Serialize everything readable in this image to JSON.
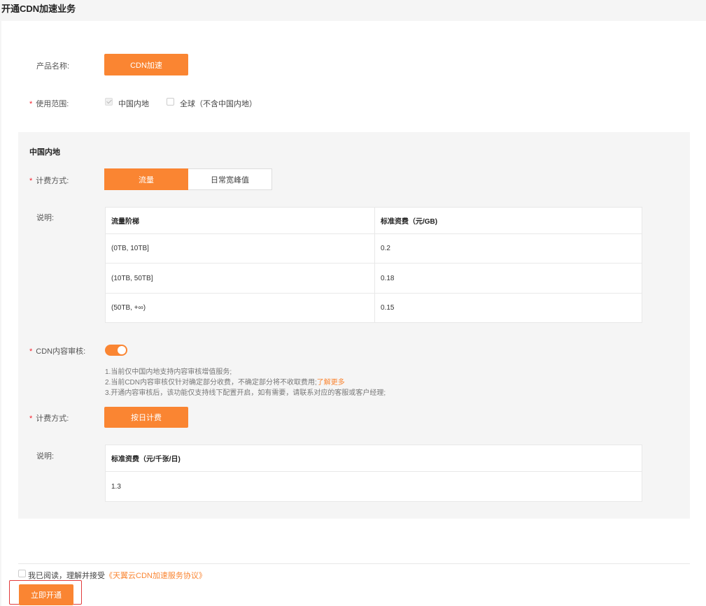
{
  "page": {
    "title": "开通CDN加速业务"
  },
  "product": {
    "label": "产品名称:",
    "value": "CDN加速"
  },
  "scope": {
    "required": "*",
    "label": "使用范围:",
    "options": [
      {
        "label": "中国内地",
        "checked": true,
        "disabled": true
      },
      {
        "label": "全球（不含中国内地）",
        "checked": false
      }
    ]
  },
  "region": {
    "title": "中国内地",
    "billing": {
      "required": "*",
      "label": "计费方式:",
      "options": [
        "流量",
        "日常宽峰值"
      ],
      "selected": "流量"
    },
    "desc_label": "说明:",
    "price_table": {
      "headers": [
        "流量阶梯",
        "标准资费（元/GB)"
      ],
      "rows": [
        [
          "(0TB, 10TB]",
          "0.2"
        ],
        [
          "(10TB, 50TB]",
          "0.18"
        ],
        [
          "(50TB, +∞)",
          "0.15"
        ]
      ]
    },
    "audit": {
      "required": "*",
      "label": "CDN内容审核:",
      "enabled": true,
      "notes": [
        "1.当前仅中国内地支持内容审核增值服务;",
        "2.当前CDN内容审核仅针对确定部分收费，不确定部分将不收取费用;",
        "3.开通内容审核后，该功能仅支持线下配置开启，如有需要，请联系对应的客服或客户经理;"
      ],
      "learn_more": "了解更多"
    },
    "audit_billing": {
      "required": "*",
      "label": "计费方式:",
      "value": "按日计费"
    },
    "audit_desc_label": "说明:",
    "audit_table": {
      "headers": [
        "标准资费（元/千张/日)"
      ],
      "rows": [
        [
          "1.3"
        ]
      ]
    }
  },
  "agreement": {
    "text": "我已阅读，理解并接受",
    "link": "《天翼云CDN加速服务协议》"
  },
  "submit": {
    "label": "立即开通"
  },
  "colors": {
    "accent": "#fa8532",
    "required": "#f5222d",
    "highlight": "#e23b3b"
  }
}
